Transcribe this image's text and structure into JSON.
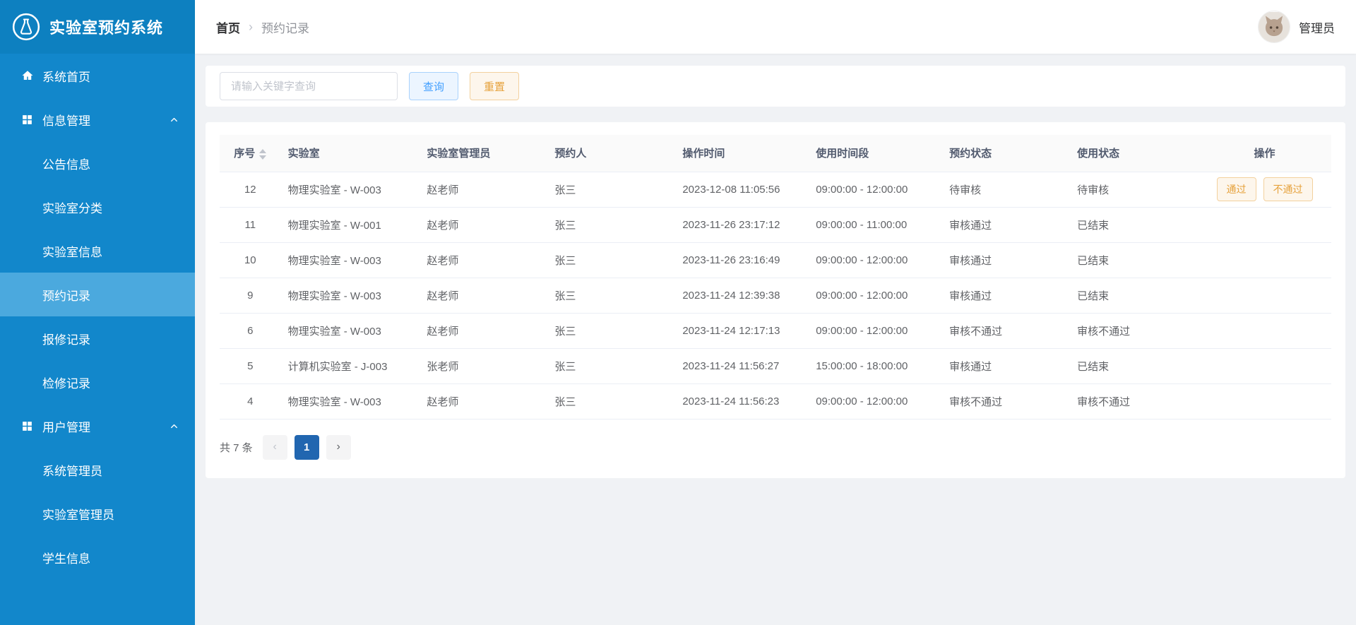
{
  "app": {
    "title": "实验室预约系统",
    "logo_icon": "flask-icon"
  },
  "colors": {
    "sidebar": "#1287cb",
    "sidebar_logo": "#0d80c0",
    "sidebar_active": "#4ba9de",
    "primary": "#409eff",
    "primary_light": "#ecf5ff",
    "primary_border": "#a9d2fc",
    "warning": "#e6a23c",
    "warning_light": "#fdf6ec",
    "warning_border": "#f3d19e",
    "page_active": "#2166b0"
  },
  "sidebar": {
    "sections": [
      {
        "type": "item",
        "key": "home",
        "icon": "home-icon",
        "label": "系统首页",
        "active": false
      },
      {
        "type": "group",
        "key": "info-management",
        "icon": "grid-icon",
        "label": "信息管理",
        "expanded": true,
        "chevron": "chevron-up-icon",
        "children": [
          {
            "key": "announcements",
            "label": "公告信息",
            "active": false
          },
          {
            "key": "lab-categories",
            "label": "实验室分类",
            "active": false
          },
          {
            "key": "lab-info",
            "label": "实验室信息",
            "active": false
          },
          {
            "key": "reservation-records",
            "label": "预约记录",
            "active": true
          },
          {
            "key": "repair-records",
            "label": "报修记录",
            "active": false
          },
          {
            "key": "maintenance-records",
            "label": "检修记录",
            "active": false
          }
        ]
      },
      {
        "type": "group",
        "key": "user-management",
        "icon": "grid-icon",
        "label": "用户管理",
        "expanded": true,
        "chevron": "chevron-up-icon",
        "children": [
          {
            "key": "system-admins",
            "label": "系统管理员",
            "active": false
          },
          {
            "key": "lab-admins",
            "label": "实验室管理员",
            "active": false
          },
          {
            "key": "student-info",
            "label": "学生信息",
            "active": false
          }
        ]
      }
    ]
  },
  "header": {
    "breadcrumb": {
      "home": "首页",
      "separator": "›",
      "current": "预约记录"
    },
    "user_name": "管理员",
    "avatar_icon": "cat-avatar"
  },
  "search": {
    "placeholder": "请输入关键字查询",
    "query_label": "查询",
    "reset_label": "重置"
  },
  "table": {
    "columns": [
      {
        "key": "seq",
        "label": "序号",
        "sortable": true
      },
      {
        "key": "lab",
        "label": "实验室",
        "sortable": false
      },
      {
        "key": "manager",
        "label": "实验室管理员",
        "sortable": false
      },
      {
        "key": "reserver",
        "label": "预约人",
        "sortable": false
      },
      {
        "key": "op_time",
        "label": "操作时间",
        "sortable": false
      },
      {
        "key": "use_period",
        "label": "使用时间段",
        "sortable": false
      },
      {
        "key": "approve_status",
        "label": "预约状态",
        "sortable": false
      },
      {
        "key": "use_status",
        "label": "使用状态",
        "sortable": false
      },
      {
        "key": "actions",
        "label": "操作",
        "sortable": false
      }
    ],
    "rows": [
      {
        "seq": "12",
        "lab": "物理实验室 - W-003",
        "manager": "赵老师",
        "reserver": "张三",
        "op_time": "2023-12-08 11:05:56",
        "use_period": "09:00:00 - 12:00:00",
        "approve_status": "待审核",
        "use_status": "待审核",
        "actions": [
          {
            "key": "approve",
            "label": "通过"
          },
          {
            "key": "reject",
            "label": "不通过"
          }
        ]
      },
      {
        "seq": "11",
        "lab": "物理实验室 - W-001",
        "manager": "赵老师",
        "reserver": "张三",
        "op_time": "2023-11-26 23:17:12",
        "use_period": "09:00:00 - 11:00:00",
        "approve_status": "审核通过",
        "use_status": "已结束",
        "actions": []
      },
      {
        "seq": "10",
        "lab": "物理实验室 - W-003",
        "manager": "赵老师",
        "reserver": "张三",
        "op_time": "2023-11-26 23:16:49",
        "use_period": "09:00:00 - 12:00:00",
        "approve_status": "审核通过",
        "use_status": "已结束",
        "actions": []
      },
      {
        "seq": "9",
        "lab": "物理实验室 - W-003",
        "manager": "赵老师",
        "reserver": "张三",
        "op_time": "2023-11-24 12:39:38",
        "use_period": "09:00:00 - 12:00:00",
        "approve_status": "审核通过",
        "use_status": "已结束",
        "actions": []
      },
      {
        "seq": "6",
        "lab": "物理实验室 - W-003",
        "manager": "赵老师",
        "reserver": "张三",
        "op_time": "2023-11-24 12:17:13",
        "use_period": "09:00:00 - 12:00:00",
        "approve_status": "审核不通过",
        "use_status": "审核不通过",
        "actions": []
      },
      {
        "seq": "5",
        "lab": "计算机实验室 - J-003",
        "manager": "张老师",
        "reserver": "张三",
        "op_time": "2023-11-24 11:56:27",
        "use_period": "15:00:00 - 18:00:00",
        "approve_status": "审核通过",
        "use_status": "已结束",
        "actions": []
      },
      {
        "seq": "4",
        "lab": "物理实验室 - W-003",
        "manager": "赵老师",
        "reserver": "张三",
        "op_time": "2023-11-24 11:56:23",
        "use_period": "09:00:00 - 12:00:00",
        "approve_status": "审核不通过",
        "use_status": "审核不通过",
        "actions": []
      }
    ]
  },
  "pagination": {
    "total_label": "共 7 条",
    "prev_icon": "‹",
    "next_icon": "›",
    "current_page": "1"
  }
}
